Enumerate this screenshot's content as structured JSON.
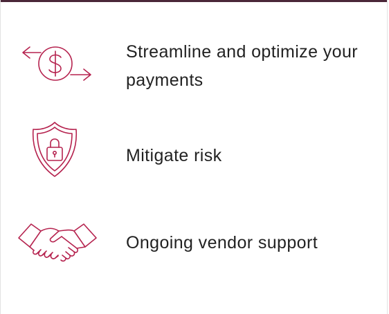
{
  "colors": {
    "accent": "#b5224e",
    "top_bar": "#4a2638",
    "text": "#222222",
    "border": "#e2e2e2"
  },
  "features": [
    {
      "icon": "dollar-exchange-icon",
      "label": "Streamline and optimize your payments"
    },
    {
      "icon": "shield-lock-icon",
      "label": "Mitigate risk"
    },
    {
      "icon": "handshake-icon",
      "label": "Ongoing vendor support"
    }
  ]
}
